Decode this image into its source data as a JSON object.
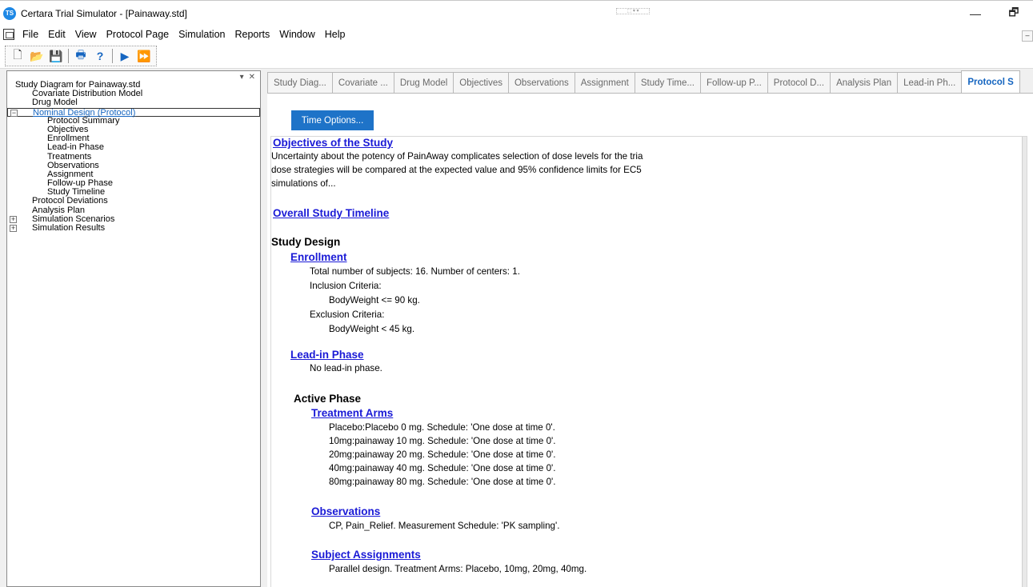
{
  "window": {
    "title": "Certara Trial Simulator - [Painaway.std]",
    "app_icon_text": "TS",
    "center_marker": "⬚ ▾ ▾",
    "minimize": "—",
    "restore": "🗗"
  },
  "menu": {
    "items": [
      "File",
      "Edit",
      "View",
      "Protocol Page",
      "Simulation",
      "Reports",
      "Window",
      "Help"
    ],
    "mdi_minimize": "–"
  },
  "toolbar": {
    "new_icon": "🗋",
    "open_icon": "📂",
    "save_icon": "💾",
    "print_icon": "🖶",
    "help_icon": "?",
    "run_icon": "▶",
    "run_all_icon": "⏩"
  },
  "tree_panel": {
    "controls": [
      "▾",
      "✕"
    ],
    "nodes": [
      {
        "label": "Study Diagram for Painaway.std",
        "indent": 0,
        "expander": ""
      },
      {
        "label": "Covariate Distribution Model",
        "indent": 1,
        "expander": ""
      },
      {
        "label": "Drug Model",
        "indent": 1,
        "expander": ""
      },
      {
        "label": "Nominal Design (Protocol)",
        "indent": 1,
        "expander": "−",
        "selected": true
      },
      {
        "label": "Protocol Summary",
        "indent": 2,
        "expander": ""
      },
      {
        "label": "Objectives",
        "indent": 2,
        "expander": ""
      },
      {
        "label": "Enrollment",
        "indent": 2,
        "expander": ""
      },
      {
        "label": "Lead-in Phase",
        "indent": 2,
        "expander": ""
      },
      {
        "label": "Treatments",
        "indent": 2,
        "expander": ""
      },
      {
        "label": "Observations",
        "indent": 2,
        "expander": ""
      },
      {
        "label": "Assignment",
        "indent": 2,
        "expander": ""
      },
      {
        "label": "Follow-up Phase",
        "indent": 2,
        "expander": ""
      },
      {
        "label": "Study Timeline",
        "indent": 2,
        "expander": ""
      },
      {
        "label": "Protocol Deviations",
        "indent": 1,
        "expander": ""
      },
      {
        "label": "Analysis Plan",
        "indent": 1,
        "expander": ""
      },
      {
        "label": "Simulation Scenarios",
        "indent": 1,
        "expander": "+"
      },
      {
        "label": "Simulation Results",
        "indent": 1,
        "expander": "+"
      }
    ]
  },
  "tabs": [
    {
      "label": "Study Diag...",
      "active": false
    },
    {
      "label": "Covariate ...",
      "active": false
    },
    {
      "label": "Drug Model",
      "active": false
    },
    {
      "label": "Objectives",
      "active": false
    },
    {
      "label": "Observations",
      "active": false
    },
    {
      "label": "Assignment",
      "active": false
    },
    {
      "label": "Study Time...",
      "active": false
    },
    {
      "label": "Follow-up P...",
      "active": false
    },
    {
      "label": "Protocol D...",
      "active": false
    },
    {
      "label": "Analysis Plan",
      "active": false
    },
    {
      "label": "Lead-in Ph...",
      "active": false
    },
    {
      "label": "Protocol S",
      "active": true
    }
  ],
  "content": {
    "time_options_button": "Time Options...",
    "objectives_heading": "Objectives of the Study",
    "objectives_lines": [
      "Uncertainty about the potency of PainAway complicates selection of dose levels for the tria",
      "dose strategies will be compared at the expected value and 95% confidence limits for EC5",
      "simulations of..."
    ],
    "timeline_heading": "Overall Study Timeline",
    "study_design_heading": "Study Design",
    "enrollment_heading": "Enrollment",
    "enrollment_lines": [
      "Total number of subjects: 16.  Number of centers: 1.",
      "Inclusion Criteria:",
      "BodyWeight <=  90 kg.",
      "Exclusion Criteria:",
      "BodyWeight <  45 kg."
    ],
    "leadin_heading": "Lead-in Phase",
    "leadin_text": "No lead-in phase.",
    "active_phase_heading": "Active Phase",
    "treatment_arms_heading": "Treatment Arms",
    "treatment_arms": [
      "Placebo:Placebo 0 mg. Schedule: 'One dose at time 0'.",
      "10mg:painaway 10 mg. Schedule: 'One dose at time 0'.",
      "20mg:painaway 20 mg. Schedule: 'One dose at time 0'.",
      "40mg:painaway 40 mg. Schedule: 'One dose at time 0'.",
      "80mg:painaway 80 mg. Schedule: 'One dose at time 0'."
    ],
    "observations_heading": "Observations",
    "observations_text": "CP, Pain_Relief. Measurement Schedule: 'PK sampling'.",
    "assignments_heading": "Subject Assignments",
    "assignments_text": "Parallel design. Treatment Arms: Placebo, 10mg, 20mg, 40mg."
  }
}
